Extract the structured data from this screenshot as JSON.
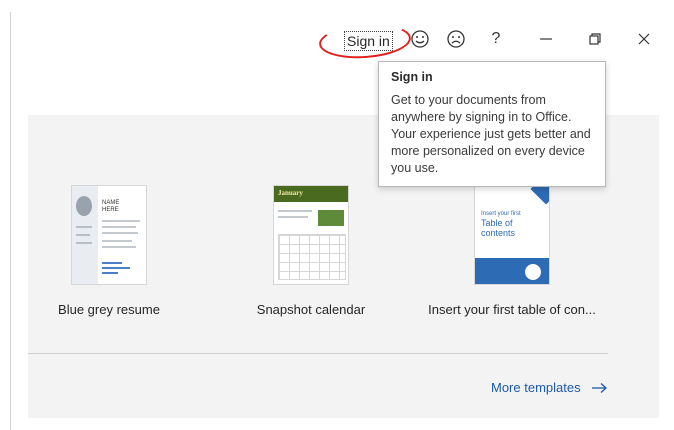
{
  "titlebar": {
    "sign_in_label": "Sign in",
    "smile_icon": "smile-icon",
    "frown_icon": "frown-icon",
    "help_label": "?",
    "minimize_icon": "minimize-icon",
    "restore_icon": "restore-icon",
    "close_icon": "close-icon"
  },
  "tooltip": {
    "title": "Sign in",
    "body": "Get to your documents from anywhere by signing in to Office. Your experience just gets better and more personalized on every device you use."
  },
  "templates": [
    {
      "label": "Blue grey resume",
      "thumb_name_line1": "NAME",
      "thumb_name_line2": "HERE"
    },
    {
      "label": "Snapshot calendar",
      "thumb_title": "January"
    },
    {
      "label": "Insert your first table of con...",
      "thumb_line1": "Insert your first",
      "thumb_line2": "Table of",
      "thumb_line3": "contents"
    }
  ],
  "more_templates_label": "More templates",
  "colors": {
    "annotation": "#e0201a",
    "link": "#1e5aa8",
    "calendar_green": "#4a6b1f",
    "toc_blue": "#2e6bb5"
  }
}
